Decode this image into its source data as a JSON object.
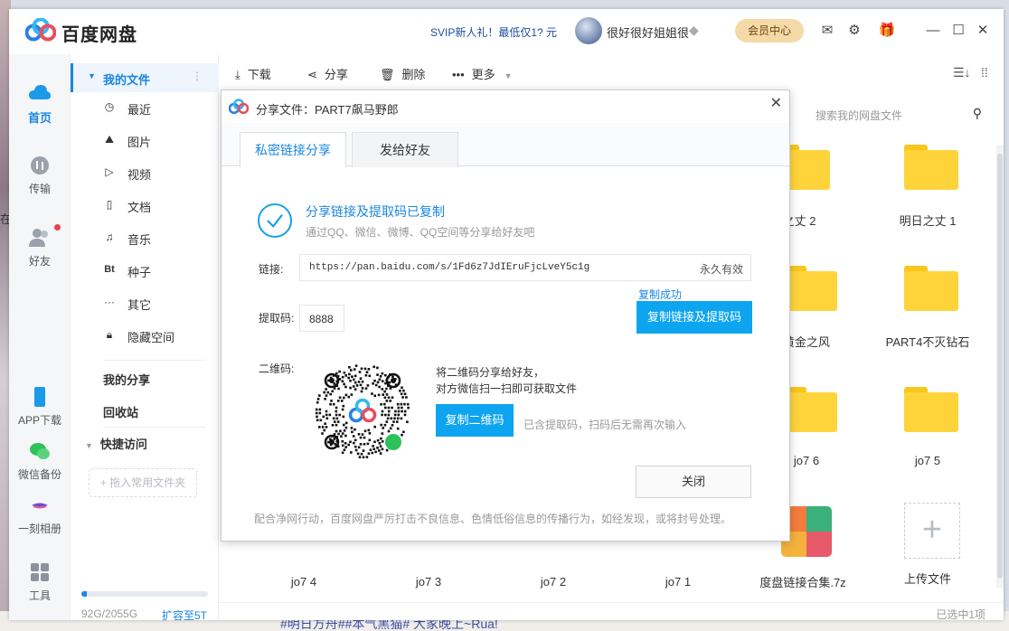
{
  "desktop": {
    "bottom_text": "#明日方舟##本气黑猫# 大家晚上~Rua!",
    "left_text": "在"
  },
  "titlebar": {
    "app_name": "百度网盘",
    "promo": "SVIP新人礼！最低仅1? 元",
    "username": "很好很好姐姐很",
    "vip_button": "会员中心"
  },
  "rail": {
    "items": [
      {
        "label": "首页",
        "icon": "cloud-icon"
      },
      {
        "label": "传输",
        "icon": "transfer-icon"
      },
      {
        "label": "好友",
        "icon": "friends-icon"
      },
      {
        "label": "APP下载",
        "icon": "phone-icon"
      },
      {
        "label": "微信备份",
        "icon": "wechat-icon"
      },
      {
        "label": "一刻相册",
        "icon": "album-icon"
      },
      {
        "label": "工具",
        "icon": "tools-icon"
      }
    ]
  },
  "sidebar": {
    "my_files": "我的文件",
    "items": [
      {
        "label": "最近",
        "icon": "clock-icon"
      },
      {
        "label": "图片",
        "icon": "image-icon"
      },
      {
        "label": "视频",
        "icon": "video-icon"
      },
      {
        "label": "文档",
        "icon": "document-icon"
      },
      {
        "label": "音乐",
        "icon": "headphones-icon"
      },
      {
        "label": "种子",
        "icon": "bt-icon"
      },
      {
        "label": "其它",
        "icon": "more-icon"
      },
      {
        "label": "隐藏空间",
        "icon": "lock-icon"
      }
    ],
    "my_share": "我的分享",
    "recycle": "回收站",
    "quick_access": "快捷访问",
    "drop_hint": "+ 拖入常用文件夹",
    "storage_text": "92G/2055G",
    "storage_fraction": 0.045,
    "expand": "扩容至5T"
  },
  "toolbar": {
    "download": "下载",
    "share": "分享",
    "delete": "删除",
    "more": "更多"
  },
  "search": {
    "placeholder": "搜索我的网盘文件"
  },
  "files": {
    "row1": [
      "之丈 2",
      "明日之丈 1"
    ],
    "row2": [
      "黄金之风",
      "PART4不灭钻石"
    ],
    "row3": [
      "jo7 6",
      "jo7 5"
    ],
    "row4": [
      "jo7 4",
      "jo7 3",
      "jo7 2",
      "jo7 1",
      "度盘链接合集.7z",
      "上传文件"
    ]
  },
  "status": {
    "selected": "已选中1项"
  },
  "dialog": {
    "title": "分享文件：PART7飙马野郎",
    "tab_private": "私密链接分享",
    "tab_friends": "发给好友",
    "success_title": "分享链接及提取码已复制",
    "success_sub": "通过QQ、微信、微博、QQ空间等分享给好友吧",
    "link_label": "链接:",
    "link_url": "https://pan.baidu.com/s/1Fd6z7JdIEruFjcLveY5c1g",
    "link_validity": "永久有效",
    "copy_success": "复制成功",
    "code_label": "提取码:",
    "code": "8888",
    "copy_link_button": "复制链接及提取码",
    "qr_label": "二维码:",
    "qr_hint1": "将二维码分享给好友，",
    "qr_hint2": "对方微信扫一扫即可获取文件",
    "copy_qr_button": "复制二维码",
    "qr_hint3": "已含提取码，扫码后无需再次输入",
    "close_button": "关闭",
    "footer": "配合净网行动，百度网盘严厉打击不良信息、色情低俗信息的传播行为，如经发现，或将封号处理。"
  },
  "colors": {
    "accent": "#1a86e0",
    "button_blue": "#0ea5f0",
    "folder": "#ffd43b",
    "vip_gold": "#f5d9a7"
  }
}
